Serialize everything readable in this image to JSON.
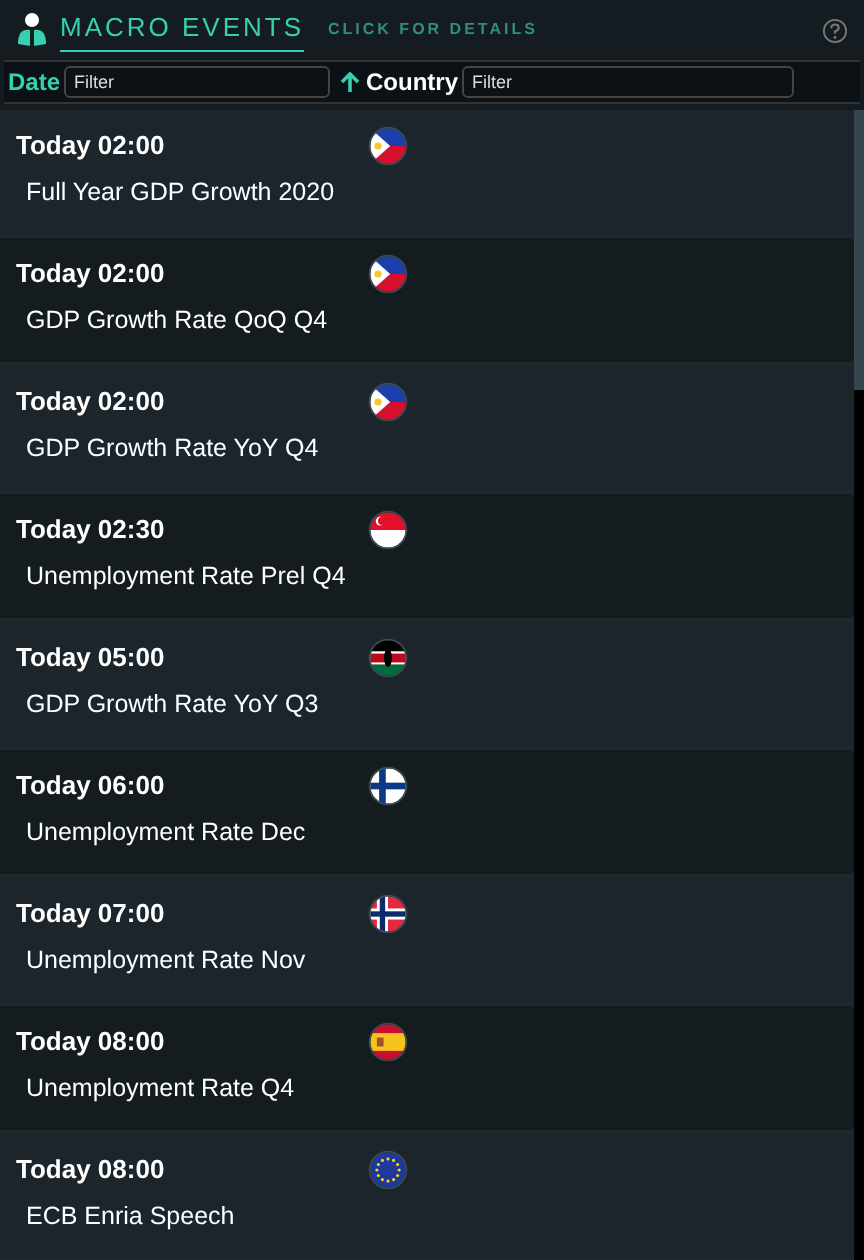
{
  "header": {
    "title": "MACRO EVENTS",
    "subtitle": "CLICK FOR DETAILS"
  },
  "filters": [
    {
      "label": "Date",
      "placeholder": "Filter",
      "sorted": true
    },
    {
      "label": "Country",
      "placeholder": "Filter",
      "sorted": false
    }
  ],
  "events": [
    {
      "time": "Today 02:00",
      "kind": "ph",
      "name": "Full Year GDP Growth 2020"
    },
    {
      "time": "Today 02:00",
      "kind": "ph",
      "name": "GDP Growth Rate QoQ Q4"
    },
    {
      "time": "Today 02:00",
      "kind": "ph",
      "name": "GDP Growth Rate YoY Q4"
    },
    {
      "time": "Today 02:30",
      "kind": "sg",
      "name": "Unemployment Rate Prel Q4"
    },
    {
      "time": "Today 05:00",
      "kind": "ke",
      "name": "GDP Growth Rate YoY Q3"
    },
    {
      "time": "Today 06:00",
      "kind": "fi",
      "name": "Unemployment Rate Dec"
    },
    {
      "time": "Today 07:00",
      "kind": "no",
      "name": "Unemployment Rate Nov"
    },
    {
      "time": "Today 08:00",
      "kind": "es",
      "name": "Unemployment Rate Q4"
    },
    {
      "time": "Today 08:00",
      "kind": "eu",
      "name": "ECB Enria Speech"
    }
  ]
}
